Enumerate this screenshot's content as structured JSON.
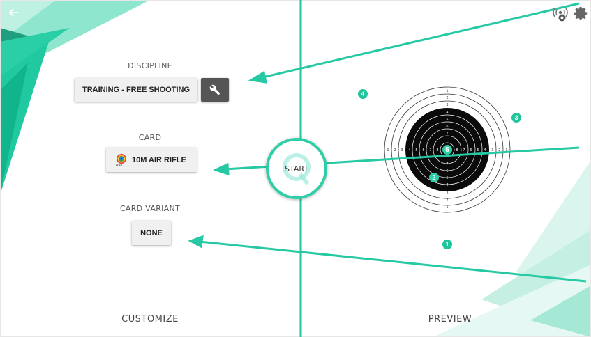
{
  "left_panel": {
    "discipline": {
      "label": "DISCIPLINE",
      "value": "TRAINING - FREE SHOOTING"
    },
    "card": {
      "label": "CARD",
      "value": "10M AIR RIFLE",
      "logo_text": "ISSF"
    },
    "card_variant": {
      "label": "CARD VARIANT",
      "value": "NONE"
    },
    "footer": "CUSTOMIZE"
  },
  "center": {
    "start_label": "START"
  },
  "right_panel": {
    "footer": "PREVIEW",
    "target": {
      "outer_ring_numbers": [
        "1",
        "2",
        "3"
      ],
      "black_ring_numbers": [
        "4",
        "5",
        "6",
        "7",
        "8"
      ],
      "center_number": "5",
      "shot_markers": [
        {
          "number": "1",
          "color": "#1fc59b"
        },
        {
          "number": "2",
          "color": "#2ecfa8"
        },
        {
          "number": "3",
          "color": "#1fc59b"
        },
        {
          "number": "4",
          "color": "#1fc59b"
        },
        {
          "number": "5",
          "color": "#2ecfa8"
        }
      ]
    }
  },
  "icons": {
    "back": "arrow-left-icon",
    "sensor": "sensor-signal-icon",
    "settings": "gear-icon",
    "wrench": "wrench-icon"
  },
  "colors": {
    "accent": "#2ecfa8",
    "accent_dark": "#11b58c",
    "arrow": "#26c9a3"
  }
}
